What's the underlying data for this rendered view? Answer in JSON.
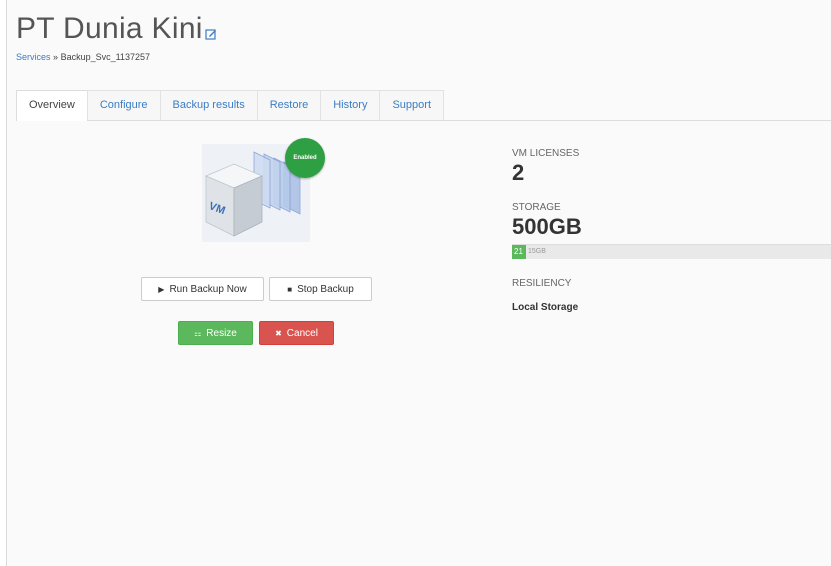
{
  "header": {
    "title": "PT Dunia Kini",
    "breadcrumb": {
      "link": "Services",
      "separator": "»",
      "current": "Backup_Svc_1137257"
    }
  },
  "tabs": [
    {
      "label": "Overview",
      "active": true
    },
    {
      "label": "Configure"
    },
    {
      "label": "Backup results"
    },
    {
      "label": "Restore"
    },
    {
      "label": "History"
    },
    {
      "label": "Support"
    }
  ],
  "vm_graphic": {
    "cube_label": "VM",
    "badge": "Enabled",
    "badge_color": "#2ea043"
  },
  "actions": {
    "run_label": "Run Backup Now",
    "stop_label": "Stop Backup",
    "resize_label": "Resize",
    "cancel_label": "Cancel"
  },
  "stats": {
    "vm_licenses_label": "VM LICENSES",
    "vm_licenses_value": "2",
    "storage_label": "STORAGE",
    "storage_value": "500GB",
    "storage_used": "21",
    "storage_used_fraction": 0.04,
    "storage_rest_text": "15GB",
    "resiliency_label": "RESILIENCY",
    "resiliency_value": "Local Storage"
  },
  "colors": {
    "link": "#3b7dc4",
    "success": "#5cb85c",
    "danger": "#d9534f"
  }
}
